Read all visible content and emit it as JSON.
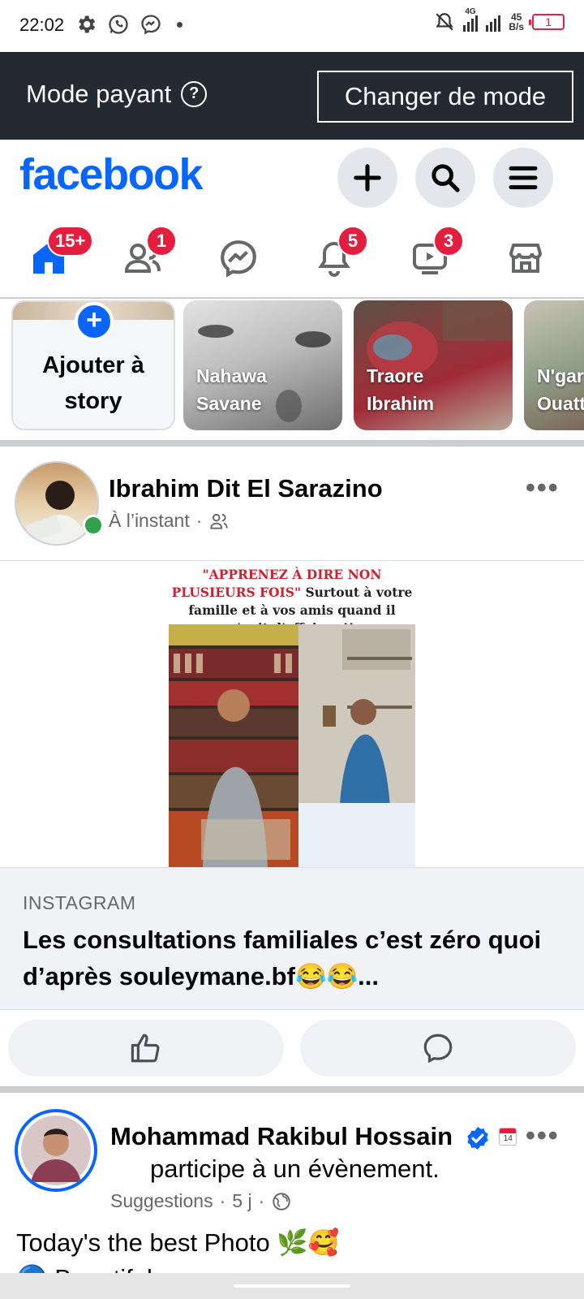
{
  "status_bar": {
    "time": "22:02",
    "network": "4G",
    "speed_value": "45",
    "speed_unit": "B/s",
    "battery": "1"
  },
  "mode_bar": {
    "label": "Mode payant",
    "help_glyph": "?",
    "switch_button": "Changer de mode"
  },
  "header": {
    "logo": "facebook",
    "brand_color": "#0866ff"
  },
  "nav_tabs": [
    {
      "name": "home",
      "badge": "15+"
    },
    {
      "name": "friends",
      "badge": "1"
    },
    {
      "name": "messenger",
      "badge": ""
    },
    {
      "name": "notifications",
      "badge": "5"
    },
    {
      "name": "video",
      "badge": "3"
    },
    {
      "name": "marketplace",
      "badge": ""
    }
  ],
  "stories": {
    "create_label": "Ajouter à story",
    "items": [
      {
        "name": "Nahawa Savane"
      },
      {
        "name": "Traore Ibrahim"
      },
      {
        "name": "N'gar Ouatt"
      }
    ]
  },
  "post1": {
    "author": "Ibrahim Dit El Sarazino",
    "time": "À l’instant",
    "separator": "·",
    "more": "•••",
    "meme": {
      "caption_red": "\"APPRENEZ À DIRE NON PLUSIEURS FOIS\"",
      "caption_black": " Surtout à votre famille et à vos amis quand il s'agit d'affaires !!"
    },
    "link": {
      "source": "INSTAGRAM",
      "title": "Les consultations familiales c’est zéro quoi d’après souleymane.bf😂😂..."
    }
  },
  "post2": {
    "author": "Mohammad Rakibul Hossain",
    "event_text": "participe à un évènement.",
    "calendar_day": "14",
    "meta_label": "Suggestions",
    "time": "5 j",
    "separator": "·",
    "more": "•••",
    "text_line1": "Today's the best Photo 🌿🥰",
    "text_line2": "🔵 Beautiful"
  }
}
